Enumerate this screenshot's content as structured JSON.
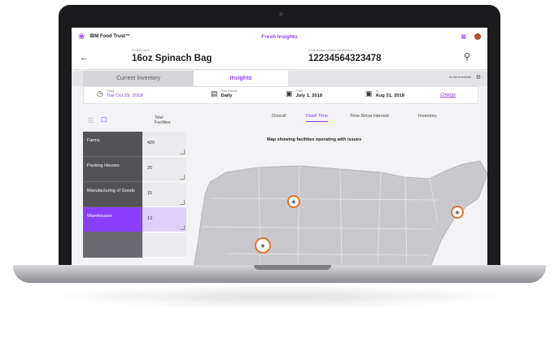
{
  "app": {
    "brand": "IBM Food Trust™",
    "title": "Fresh Insights"
  },
  "product": {
    "name_label": "Product name",
    "name": "16oz Spinach Bag",
    "gtin_label": "GTIN or other product identification",
    "gtin": "12234564323478"
  },
  "tabs": [
    {
      "label": "Current Inventory",
      "active": false
    },
    {
      "label": "Insights",
      "active": true
    }
  ],
  "threshold_label": "At risk threshold",
  "dates": {
    "today_label": "Today",
    "today_value": "Tue Oct 29, 2018",
    "interval_label": "Data Interval",
    "interval_value": "Daily",
    "from_label": "From",
    "from_value": "July 1, 2018",
    "to_label": "To",
    "to_value": "Aug 31, 2018",
    "change_label": "Change"
  },
  "facilities": {
    "header": "Total Facilities",
    "rows": [
      {
        "name": "Farms",
        "count": "420",
        "active": false
      },
      {
        "name": "Packing Houses",
        "count": "20",
        "active": false
      },
      {
        "name": "Manufacturing of Goods",
        "count": "15",
        "active": false
      },
      {
        "name": "Warehouses",
        "count": "13",
        "active": true
      }
    ]
  },
  "view_tabs": [
    {
      "label": "Overall",
      "active": false
    },
    {
      "label": "Dwell Time",
      "active": true
    },
    {
      "label": "Time Since Harvest",
      "active": false
    },
    {
      "label": "Inventory",
      "active": false
    }
  ],
  "map_caption": "Map showing facilities operating with issues",
  "colors": {
    "accent": "#8a3ffc",
    "pin": "#e0752d",
    "facility_dark": "#525257"
  },
  "icons": {
    "logo": "grape-icon",
    "grid": "app-grid-icon",
    "back": "arrow-left-icon",
    "search": "search-icon",
    "settings": "gear-icon",
    "clock": "clock-icon",
    "chart": "bar-chart-icon",
    "calendar": "calendar-icon",
    "pin": "map-pin-icon"
  }
}
